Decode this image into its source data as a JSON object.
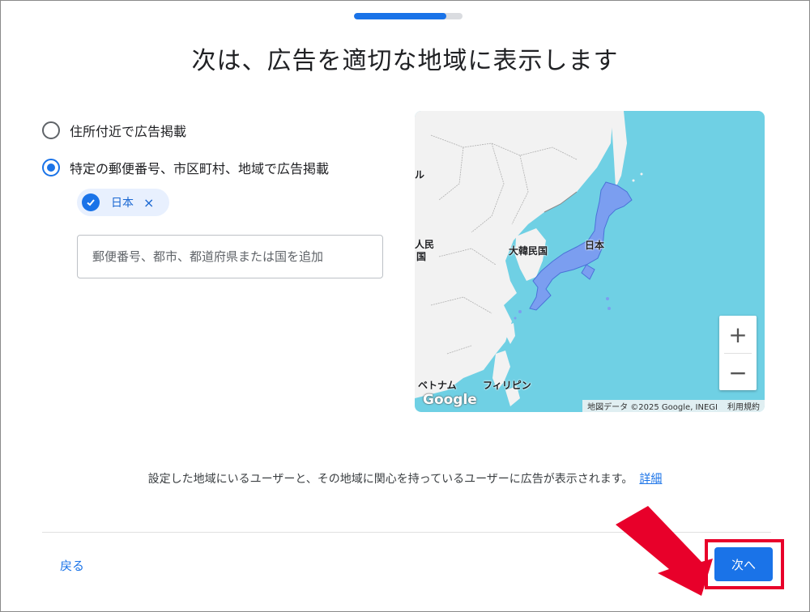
{
  "progress": {
    "fraction": 0.85
  },
  "title": "次は、広告を適切な地域に表示します",
  "options": [
    {
      "label": "住所付近で広告掲載",
      "selected": false
    },
    {
      "label": "特定の郵便番号、市区町村、地域で広告掲載",
      "selected": true
    }
  ],
  "chip": {
    "label": "日本",
    "close_icon": "×"
  },
  "location_input": {
    "placeholder": "郵便番号、都市、都道府県または国を追加",
    "value": ""
  },
  "map": {
    "labels": {
      "korea": "大韓民国",
      "japan": "日本",
      "vietnam": "ベトナム",
      "philippines": "フィリピン",
      "left_edge_top": "ル",
      "left_edge_mid1": "人民",
      "left_edge_mid2": "国"
    },
    "zoom_in": "+",
    "zoom_out": "−",
    "google_logo": "Google",
    "attribution": "地図データ ©2025 Google, INEGI",
    "terms": "利用規約",
    "colors": {
      "water": "#6fd0e4",
      "land": "#f2f2f2",
      "highlight": "#7b9ef0"
    }
  },
  "info": {
    "text": "設定した地域にいるユーザーと、その地域に関心を持っているユーザーに広告が表示されます。",
    "link": "詳細"
  },
  "footer": {
    "back_label": "戻る",
    "next_label": "次へ"
  },
  "colors": {
    "accent": "#1a73e8",
    "highlight_box": "#e8002a"
  }
}
